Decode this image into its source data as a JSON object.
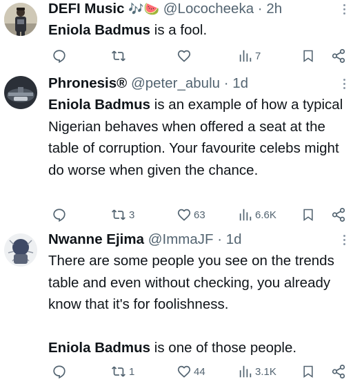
{
  "tweets": [
    {
      "name": "DEFI Music",
      "name_emoji": "🎶🍉",
      "handle_time": "@Lococheeka · 2h",
      "mention": "Eniola Badmus",
      "text": " is a fool.",
      "replies": "",
      "retweets": "",
      "likes": "",
      "views": "7"
    },
    {
      "name": "Phronesis®",
      "handle_time": "@peter_abulu · 1d",
      "mention": "Eniola Badmus",
      "text": " is an example of how a typical Nigerian behaves when offered a seat at the table of corruption. Your favourite celebs might do worse when given the chance.",
      "replies": "",
      "retweets": "3",
      "likes": "63",
      "views": "6.6K"
    },
    {
      "name": "Nwanne Ejima",
      "handle_time": "@ImmaJF · 1d",
      "text": "There are some people you see on the trends table and even without checking, you already know that it's for foolishness.",
      "mention": "Eniola Badmus",
      "text2": " is one of those people.",
      "replies": "",
      "retweets": "1",
      "likes": "44",
      "views": "3.1K"
    }
  ],
  "colors": {
    "text": "#0f1419",
    "secondary": "#536471",
    "background": "#ffffff"
  }
}
